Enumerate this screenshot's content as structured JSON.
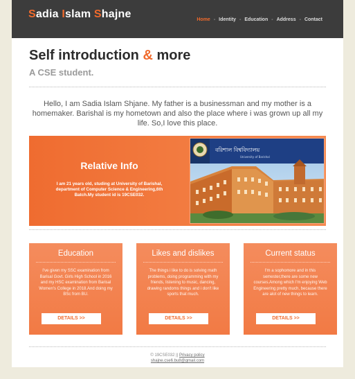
{
  "header": {
    "logo_parts": [
      {
        "first": "S",
        "rest": "adia "
      },
      {
        "first": "I",
        "rest": "slam "
      },
      {
        "first": "S",
        "rest": "hajne"
      }
    ],
    "nav": [
      {
        "label": "Home",
        "active": true
      },
      {
        "label": "Identity",
        "active": false
      },
      {
        "label": "Education",
        "active": false
      },
      {
        "label": "Address",
        "active": false
      },
      {
        "label": "Contact",
        "active": false
      }
    ]
  },
  "main": {
    "title_pre": "Self introduction ",
    "title_amp": "&",
    "title_post": " more",
    "subtitle": "A CSE student.",
    "intro": "Hello, I am Sadia Islam Shjane. My father is a businessman and my mother is a homemaker. Barishal is my hometown and also the place where i was grown up all my life. So,I love this place."
  },
  "feature": {
    "heading": "Relative Info",
    "text": "I am 21 years old, studing at University of Barishal, department of Computer Science & Engineering,6th Batch.My student id is 19CSE032."
  },
  "boxes": [
    {
      "title": "Education",
      "text": "I've given my SSC examination from Barisal Govt. Girls High School in 2016 and my HSC examination from Barisal Women's College in 2018.And doing my BSc from BU.",
      "button": "DETAILS >>"
    },
    {
      "title": "Likes and dislikes",
      "text": "The things i like to do is solving math problems, doing programming with my friends, listening to music, dancing, drawing randoms things and i don't like sports that much.",
      "button": "DETAILS >>"
    },
    {
      "title": "Current status",
      "text": "I'm a sophomore and in this semester,there are some new courses.Among which I'm enjoying Web Engineering pretty much, because there are alot of new things to learn.",
      "button": "DETAILS >>"
    }
  ],
  "footer": {
    "copyright": "© 19CSE032 || ",
    "privacy": "Privacy policy",
    "email": "shajne.cse6.bu8@gmail.com"
  },
  "colors": {
    "accent": "#f06a2c",
    "header_bg": "#3c3c3c",
    "page_bg": "#eeebdd"
  }
}
